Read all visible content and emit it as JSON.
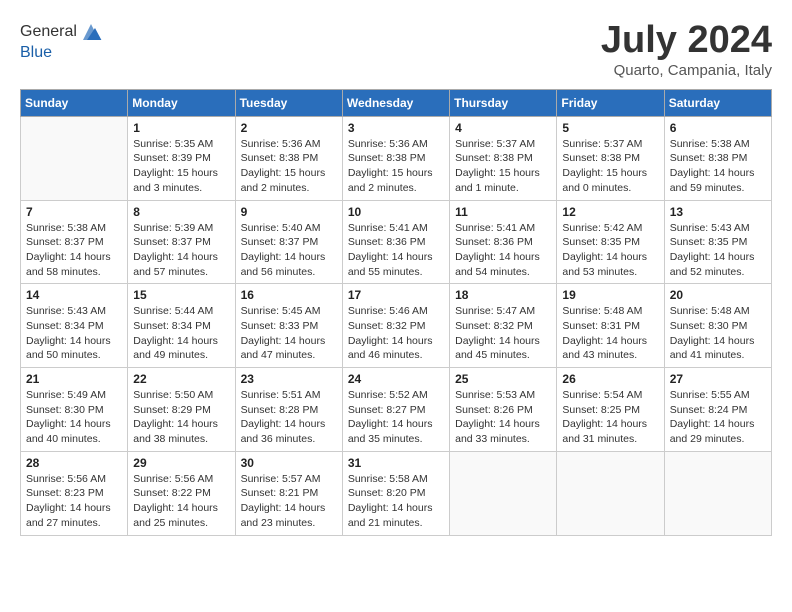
{
  "header": {
    "logo_line1": "General",
    "logo_line2": "Blue",
    "month_title": "July 2024",
    "location": "Quarto, Campania, Italy"
  },
  "calendar": {
    "days_of_week": [
      "Sunday",
      "Monday",
      "Tuesday",
      "Wednesday",
      "Thursday",
      "Friday",
      "Saturday"
    ],
    "weeks": [
      [
        {
          "day": "",
          "info": ""
        },
        {
          "day": "1",
          "info": "Sunrise: 5:35 AM\nSunset: 8:39 PM\nDaylight: 15 hours\nand 3 minutes."
        },
        {
          "day": "2",
          "info": "Sunrise: 5:36 AM\nSunset: 8:38 PM\nDaylight: 15 hours\nand 2 minutes."
        },
        {
          "day": "3",
          "info": "Sunrise: 5:36 AM\nSunset: 8:38 PM\nDaylight: 15 hours\nand 2 minutes."
        },
        {
          "day": "4",
          "info": "Sunrise: 5:37 AM\nSunset: 8:38 PM\nDaylight: 15 hours\nand 1 minute."
        },
        {
          "day": "5",
          "info": "Sunrise: 5:37 AM\nSunset: 8:38 PM\nDaylight: 15 hours\nand 0 minutes."
        },
        {
          "day": "6",
          "info": "Sunrise: 5:38 AM\nSunset: 8:38 PM\nDaylight: 14 hours\nand 59 minutes."
        }
      ],
      [
        {
          "day": "7",
          "info": "Sunrise: 5:38 AM\nSunset: 8:37 PM\nDaylight: 14 hours\nand 58 minutes."
        },
        {
          "day": "8",
          "info": "Sunrise: 5:39 AM\nSunset: 8:37 PM\nDaylight: 14 hours\nand 57 minutes."
        },
        {
          "day": "9",
          "info": "Sunrise: 5:40 AM\nSunset: 8:37 PM\nDaylight: 14 hours\nand 56 minutes."
        },
        {
          "day": "10",
          "info": "Sunrise: 5:41 AM\nSunset: 8:36 PM\nDaylight: 14 hours\nand 55 minutes."
        },
        {
          "day": "11",
          "info": "Sunrise: 5:41 AM\nSunset: 8:36 PM\nDaylight: 14 hours\nand 54 minutes."
        },
        {
          "day": "12",
          "info": "Sunrise: 5:42 AM\nSunset: 8:35 PM\nDaylight: 14 hours\nand 53 minutes."
        },
        {
          "day": "13",
          "info": "Sunrise: 5:43 AM\nSunset: 8:35 PM\nDaylight: 14 hours\nand 52 minutes."
        }
      ],
      [
        {
          "day": "14",
          "info": "Sunrise: 5:43 AM\nSunset: 8:34 PM\nDaylight: 14 hours\nand 50 minutes."
        },
        {
          "day": "15",
          "info": "Sunrise: 5:44 AM\nSunset: 8:34 PM\nDaylight: 14 hours\nand 49 minutes."
        },
        {
          "day": "16",
          "info": "Sunrise: 5:45 AM\nSunset: 8:33 PM\nDaylight: 14 hours\nand 47 minutes."
        },
        {
          "day": "17",
          "info": "Sunrise: 5:46 AM\nSunset: 8:32 PM\nDaylight: 14 hours\nand 46 minutes."
        },
        {
          "day": "18",
          "info": "Sunrise: 5:47 AM\nSunset: 8:32 PM\nDaylight: 14 hours\nand 45 minutes."
        },
        {
          "day": "19",
          "info": "Sunrise: 5:48 AM\nSunset: 8:31 PM\nDaylight: 14 hours\nand 43 minutes."
        },
        {
          "day": "20",
          "info": "Sunrise: 5:48 AM\nSunset: 8:30 PM\nDaylight: 14 hours\nand 41 minutes."
        }
      ],
      [
        {
          "day": "21",
          "info": "Sunrise: 5:49 AM\nSunset: 8:30 PM\nDaylight: 14 hours\nand 40 minutes."
        },
        {
          "day": "22",
          "info": "Sunrise: 5:50 AM\nSunset: 8:29 PM\nDaylight: 14 hours\nand 38 minutes."
        },
        {
          "day": "23",
          "info": "Sunrise: 5:51 AM\nSunset: 8:28 PM\nDaylight: 14 hours\nand 36 minutes."
        },
        {
          "day": "24",
          "info": "Sunrise: 5:52 AM\nSunset: 8:27 PM\nDaylight: 14 hours\nand 35 minutes."
        },
        {
          "day": "25",
          "info": "Sunrise: 5:53 AM\nSunset: 8:26 PM\nDaylight: 14 hours\nand 33 minutes."
        },
        {
          "day": "26",
          "info": "Sunrise: 5:54 AM\nSunset: 8:25 PM\nDaylight: 14 hours\nand 31 minutes."
        },
        {
          "day": "27",
          "info": "Sunrise: 5:55 AM\nSunset: 8:24 PM\nDaylight: 14 hours\nand 29 minutes."
        }
      ],
      [
        {
          "day": "28",
          "info": "Sunrise: 5:56 AM\nSunset: 8:23 PM\nDaylight: 14 hours\nand 27 minutes."
        },
        {
          "day": "29",
          "info": "Sunrise: 5:56 AM\nSunset: 8:22 PM\nDaylight: 14 hours\nand 25 minutes."
        },
        {
          "day": "30",
          "info": "Sunrise: 5:57 AM\nSunset: 8:21 PM\nDaylight: 14 hours\nand 23 minutes."
        },
        {
          "day": "31",
          "info": "Sunrise: 5:58 AM\nSunset: 8:20 PM\nDaylight: 14 hours\nand 21 minutes."
        },
        {
          "day": "",
          "info": ""
        },
        {
          "day": "",
          "info": ""
        },
        {
          "day": "",
          "info": ""
        }
      ]
    ]
  }
}
